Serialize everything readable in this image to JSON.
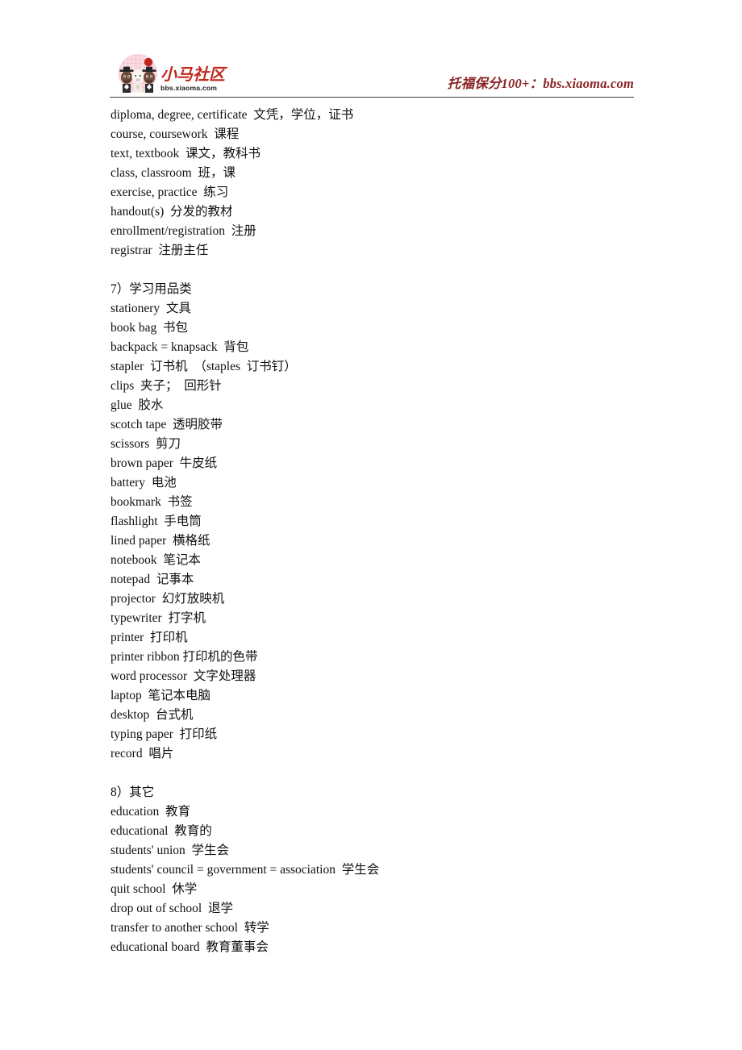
{
  "banner": {
    "logo_name": "xiaoma-community-logo",
    "logo_chinese": "小马社区",
    "logo_url": "bbs.xiaoma.com",
    "slogan": "托福保分100+：bbs.xiaoma.com",
    "slogan_color": "#8B2525",
    "logo_red": "#C0281E",
    "logo_pink": "#F2B8C6",
    "rule_color": "#3b3b3b"
  },
  "document": {
    "blocks": [
      {
        "id": "block-vocab-academic-tail",
        "heading": null,
        "lines": [
          "diploma, degree, certificate  文凭，学位，证书",
          "course, coursework  课程",
          "text, textbook  课文，教科书",
          "class, classroom  班，课",
          "exercise, practice  练习",
          "handout(s)  分发的教材",
          "enrollment/registration  注册",
          "registrar  注册主任"
        ]
      },
      {
        "id": "block-section-7",
        "heading": "7）学习用品类",
        "lines": [
          "stationery  文具",
          "book bag  书包",
          "backpack = knapsack  背包",
          "stapler  订书机  （staples  订书钉）",
          "clips  夹子；  回形针",
          "glue  胶水",
          "scotch tape  透明胶带",
          "scissors  剪刀",
          "brown paper  牛皮纸",
          "battery  电池",
          "bookmark  书签",
          "flashlight  手电筒",
          "lined paper  横格纸",
          "notebook  笔记本",
          "notepad  记事本",
          "projector  幻灯放映机",
          "typewriter  打字机",
          "printer  打印机",
          "printer ribbon 打印机的色带",
          "word processor  文字处理器",
          "laptop  笔记本电脑",
          "desktop  台式机",
          "typing paper  打印纸",
          "record  唱片"
        ]
      },
      {
        "id": "block-section-8",
        "heading": "8）其它",
        "lines": [
          "education  教育",
          "educational  教育的",
          "students' union  学生会",
          "students' council = government = association  学生会",
          "quit school  休学",
          "drop out of school  退学",
          "transfer to another school  转学",
          "educational board  教育董事会"
        ]
      }
    ]
  }
}
